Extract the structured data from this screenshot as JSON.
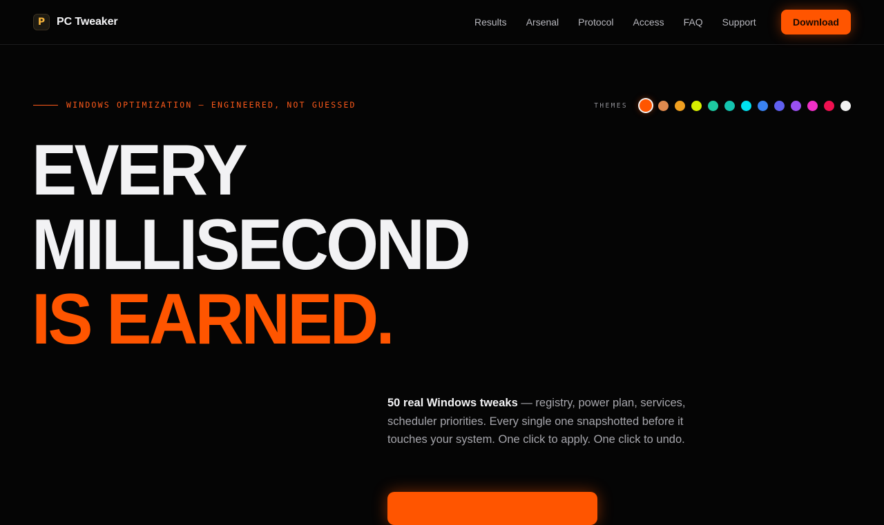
{
  "nav": {
    "brand_logo": "P",
    "brand_name": "PC Tweaker",
    "links": [
      "Results",
      "Arsenal",
      "Protocol",
      "Access",
      "FAQ",
      "Support"
    ],
    "download_label": "Download"
  },
  "hero": {
    "eyebrow": "WINDOWS OPTIMIZATION — ENGINEERED, NOT GUESSED",
    "themes_label": "THEMES",
    "themes": [
      {
        "color": "#ff5500",
        "active": true
      },
      {
        "color": "#e08a4e"
      },
      {
        "color": "#f0a020"
      },
      {
        "color": "#d8f000"
      },
      {
        "color": "#1ec8a0"
      },
      {
        "color": "#14c4b0"
      },
      {
        "color": "#00e0f0"
      },
      {
        "color": "#3a82f0"
      },
      {
        "color": "#6060f0"
      },
      {
        "color": "#9a50f0"
      },
      {
        "color": "#f030c8"
      },
      {
        "color": "#f01050"
      },
      {
        "color": "#f2f2f2"
      }
    ],
    "headline_line1": "EVERY",
    "headline_line2": "MILLISECOND",
    "headline_line3": "IS EARNED.",
    "desc_strong": "50 real Windows tweaks",
    "desc_rest": " — registry, power plan, services, scheduler priorities. Every single one snapshotted before it touches your system. One click to apply. One click to undo."
  },
  "colors": {
    "accent": "#ff5500",
    "background": "#050505"
  }
}
